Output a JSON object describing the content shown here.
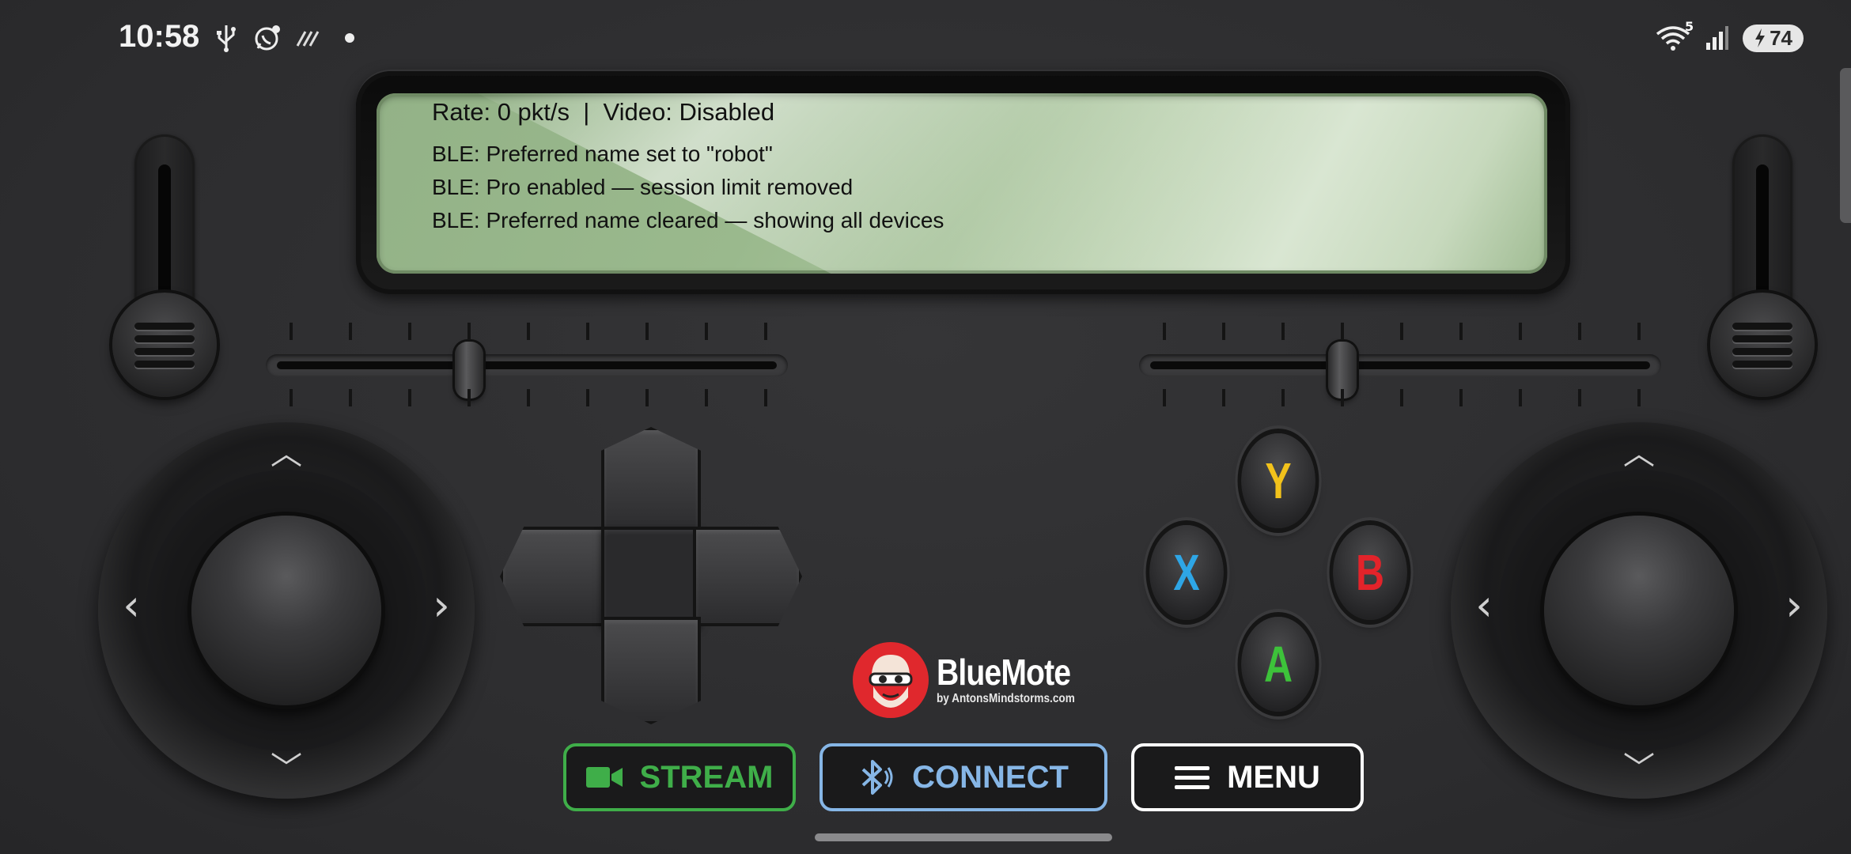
{
  "status_bar": {
    "time": "10:58",
    "left_icons": [
      "usb-icon",
      "whatsapp-icon",
      "no-signal-icon",
      "dot-icon"
    ],
    "wifi_badge": "5",
    "battery_level": "74"
  },
  "lcd": {
    "header": "Rate: 0 pkt/s  |  Video: Disabled",
    "log": [
      "BLE: Preferred name set to \"robot\"",
      "BLE: Pro enabled — session limit removed",
      "BLE: Preferred name cleared — showing all devices"
    ]
  },
  "sliders": {
    "left_horizontal_value": 0.5,
    "right_horizontal_value": 0.5
  },
  "face_buttons": {
    "y": {
      "label": "Y",
      "color": "#f2c21b"
    },
    "x": {
      "label": "X",
      "color": "#2ea6e6"
    },
    "b": {
      "label": "B",
      "color": "#e3232a"
    },
    "a": {
      "label": "A",
      "color": "#3dc23a"
    }
  },
  "logo": {
    "name": "BlueMote",
    "subtitle": "by AntonsMindstorms.com"
  },
  "buttons": {
    "stream": {
      "label": "STREAM",
      "icon": "video-camera-icon",
      "color": "#3fae49"
    },
    "connect": {
      "label": "CONNECT",
      "icon": "bluetooth-icon",
      "color": "#86b6e6"
    },
    "menu": {
      "label": "MENU",
      "icon": "hamburger-icon",
      "color": "#ffffff"
    }
  },
  "joystick_arrows": {
    "up": "︿",
    "down": "﹀",
    "left": "‹",
    "right": "›"
  }
}
